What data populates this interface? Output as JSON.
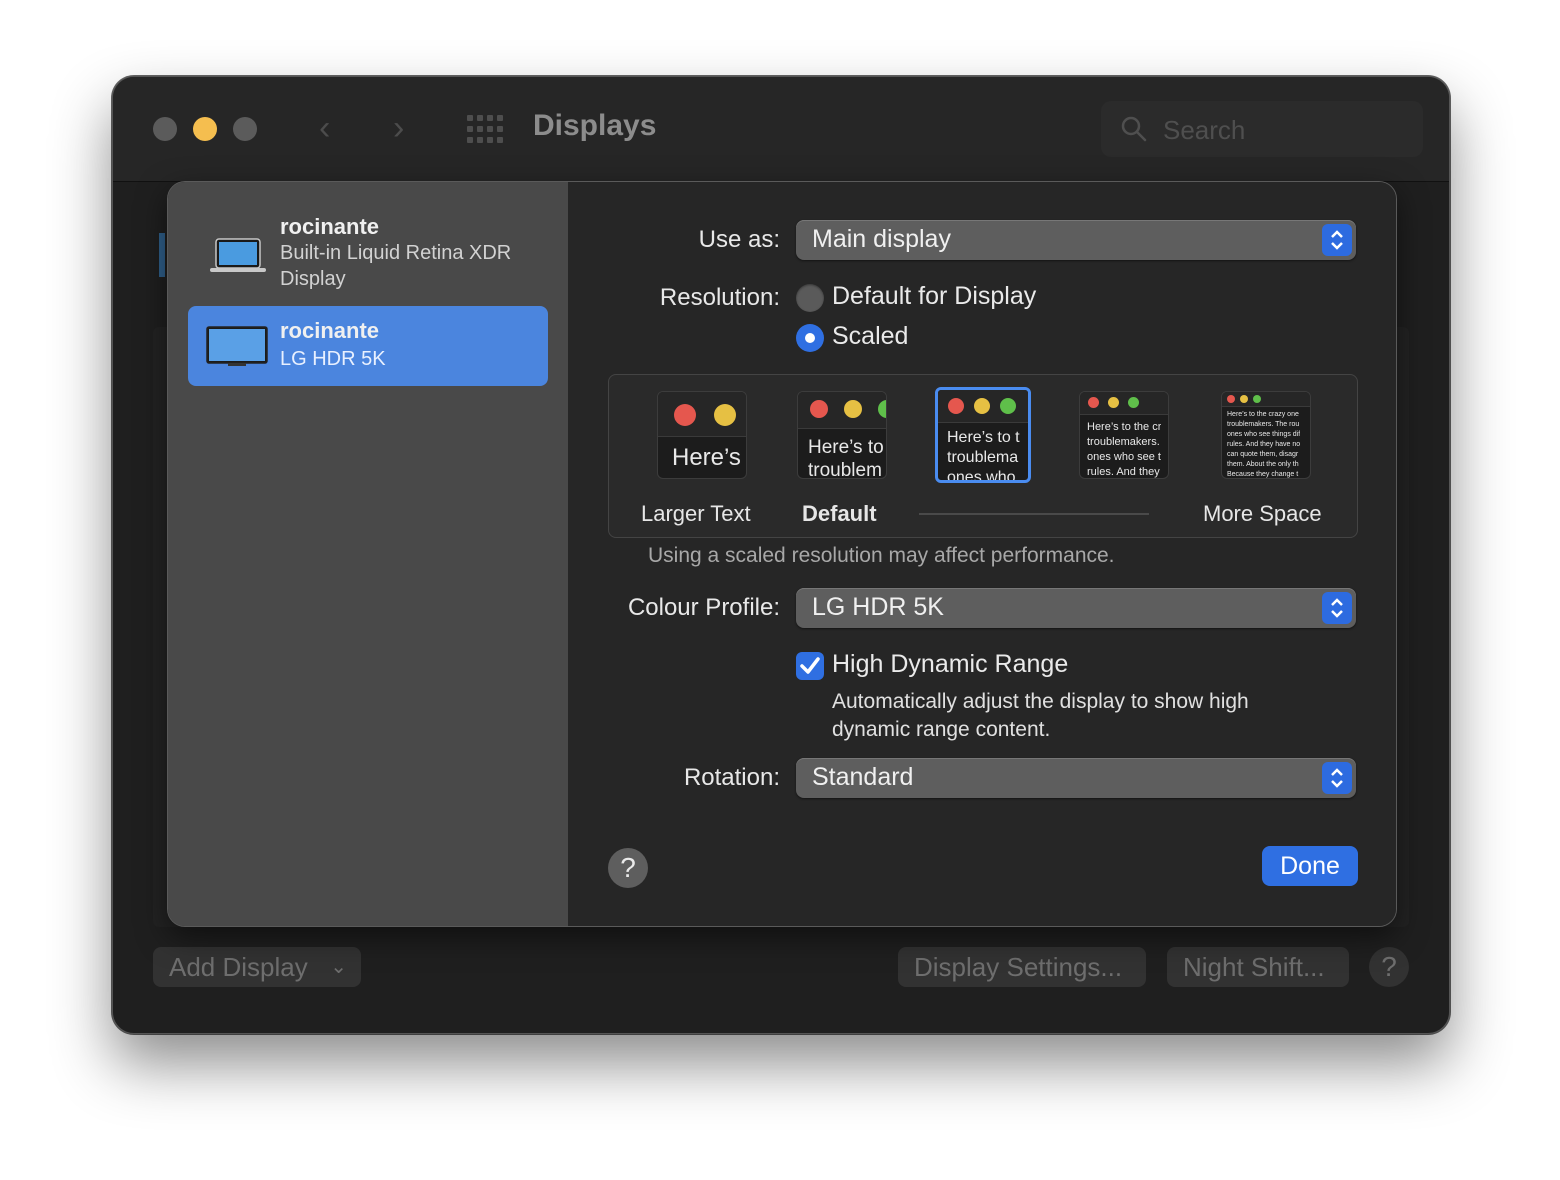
{
  "window": {
    "title": "Displays",
    "search_placeholder": "Search"
  },
  "displays": [
    {
      "name": "rocinante",
      "subtitle": "Built-in Liquid Retina XDR Display",
      "selected": false
    },
    {
      "name": "rocinante",
      "subtitle": "LG HDR 5K",
      "selected": true
    }
  ],
  "settings": {
    "use_as_label": "Use as:",
    "use_as_value": "Main display",
    "resolution_label": "Resolution:",
    "resolution_options": [
      "Default for Display",
      "Scaled"
    ],
    "resolution_selected": "Scaled",
    "scale_thumbs": [
      {
        "text": "Here’s",
        "label": "Larger Text"
      },
      {
        "text": "Here’s to\ntroublem",
        "label": "Default"
      },
      {
        "text": "Here’s to t\ntroublema\nones who",
        "label": ""
      },
      {
        "text": "Here’s to the cr\ntroublemakers.\nones who see t\nrules. And they",
        "label": ""
      },
      {
        "text": "Here’s to the crazy one\ntroublemakers. The rou\nones who see things dif\nrules. And they have no\ncan quote them, disagr\nthem. About the only th\nBecause they change t",
        "label": "More Space"
      }
    ],
    "scale_selected_index": 2,
    "performance_note": "Using a scaled resolution may affect performance.",
    "colour_profile_label": "Colour Profile:",
    "colour_profile_value": "LG HDR 5K",
    "hdr_label": "High Dynamic Range",
    "hdr_checked": true,
    "hdr_description": "Automatically adjust the display to show high dynamic range content.",
    "rotation_label": "Rotation:",
    "rotation_value": "Standard",
    "help_glyph": "?",
    "done_label": "Done"
  },
  "bottom_bar": {
    "add_display": "Add Display",
    "display_settings": "Display Settings...",
    "night_shift": "Night Shift...",
    "help_glyph": "?"
  },
  "colors": {
    "accent": "#2f6fe2",
    "selection": "#4b85de",
    "traffic_yellow": "#f5be4f",
    "dot_red": "#e5574e",
    "dot_yellow": "#e6c043",
    "dot_green": "#5fbf4a"
  }
}
